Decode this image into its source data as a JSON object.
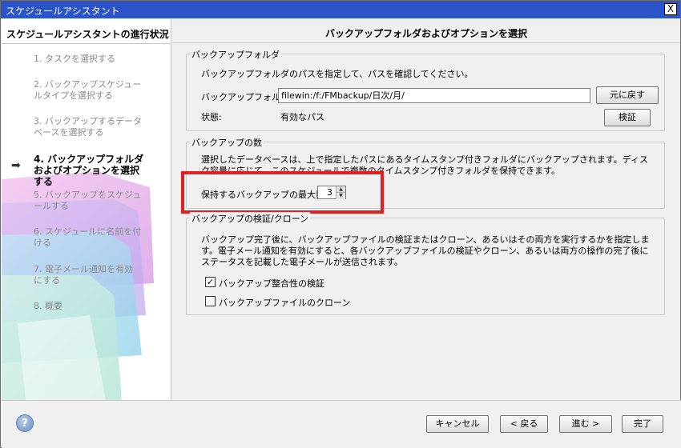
{
  "window": {
    "title": "スケジュールアシスタント",
    "close_label": "X"
  },
  "sidebar": {
    "header": "スケジュールアシスタントの進行状況",
    "steps": [
      {
        "label": "1. タスクを選択する",
        "state": "completed"
      },
      {
        "label": "2. バックアップスケジュールタイプを選択する",
        "state": "completed"
      },
      {
        "label": "3. バックアップするデータベースを選択する",
        "state": "completed"
      },
      {
        "label": "4. バックアップフォルダおよびオプションを選択する",
        "state": "current"
      },
      {
        "label": "5. バックアップをスケジュールする",
        "state": "pending"
      },
      {
        "label": "6. スケジュールに名前を付ける",
        "state": "pending"
      },
      {
        "label": "7. 電子メール通知を有効にする",
        "state": "pending"
      },
      {
        "label": "8. 概要",
        "state": "pending"
      }
    ],
    "current_arrow_icon": "arrow-right-icon"
  },
  "main": {
    "title": "バックアップフォルダおよびオプションを選択",
    "folder_group": {
      "title": "バックアップフォルダ",
      "instruction": "バックアップフォルダのパスを指定して、パスを確認してください。",
      "path_label": "バックアップフォルダ:",
      "path_value": "filewin:/f:/FMbackup/日次/月/",
      "revert_button": "元に戻す",
      "status_label": "状態:",
      "status_value": "有効なパス",
      "verify_button": "検証"
    },
    "count_group": {
      "title": "バックアップの数",
      "description": "選択したデータベースは、上で指定したパスにあるタイムスタンプ付きフォルダにバックアップされます。ディスク容量に応じて、このスケジュールで複数のタイムスタンプ付きフォルダを保持できます。",
      "max_label": "保持するバックアップの最大数:",
      "max_value": "3"
    },
    "verify_group": {
      "title": "バックアップの検証/クローン",
      "description": "バックアップ完了後に、バックアップファイルの検証またはクローン、あるいはその両方を実行するかを指定します。電子メール通知を有効にすると、各バックアップファイルの検証やクローン、あるいは両方の操作の完了後にステータスを記載した電子メールが送信されます。",
      "options": [
        {
          "label": "バックアップ整合性の検証",
          "checked": true
        },
        {
          "label": "バックアップファイルのクローン",
          "checked": false
        }
      ]
    }
  },
  "footer": {
    "help_label": "?",
    "cancel": "キャンセル",
    "back": "< 戻る",
    "next": "進む >",
    "finish": "完了"
  },
  "colors": {
    "title_bar": "#2a54c8",
    "highlight": "#e02020"
  }
}
